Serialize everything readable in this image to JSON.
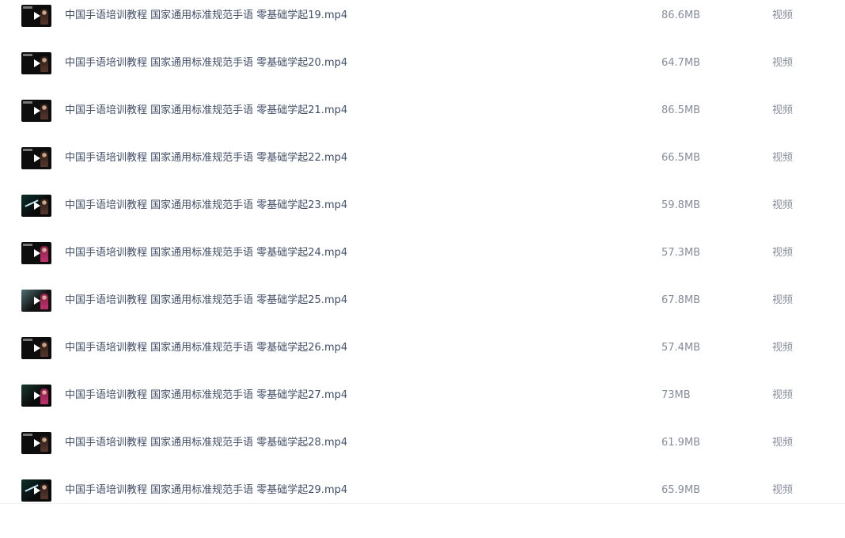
{
  "files": [
    {
      "name": "中国手语培训教程 国家通用标准规范手语 零基础学起19.mp4",
      "size": "86.6MB",
      "type": "视频",
      "thumb": "video-thumbnail"
    },
    {
      "name": "中国手语培训教程 国家通用标准规范手语 零基础学起20.mp4",
      "size": "64.7MB",
      "type": "视频",
      "thumb": "video-thumbnail"
    },
    {
      "name": "中国手语培训教程 国家通用标准规范手语 零基础学起21.mp4",
      "size": "86.5MB",
      "type": "视频",
      "thumb": "video-thumbnail"
    },
    {
      "name": "中国手语培训教程 国家通用标准规范手语 零基础学起22.mp4",
      "size": "66.5MB",
      "type": "视频",
      "thumb": "video-thumbnail"
    },
    {
      "name": "中国手语培训教程 国家通用标准规范手语 零基础学起23.mp4",
      "size": "59.8MB",
      "type": "视频",
      "thumb": "video-thumbnail"
    },
    {
      "name": "中国手语培训教程 国家通用标准规范手语 零基础学起24.mp4",
      "size": "57.3MB",
      "type": "视频",
      "thumb": "video-thumbnail"
    },
    {
      "name": "中国手语培训教程 国家通用标准规范手语 零基础学起25.mp4",
      "size": "67.8MB",
      "type": "视频",
      "thumb": "video-thumbnail"
    },
    {
      "name": "中国手语培训教程 国家通用标准规范手语 零基础学起26.mp4",
      "size": "57.4MB",
      "type": "视频",
      "thumb": "video-thumbnail"
    },
    {
      "name": "中国手语培训教程 国家通用标准规范手语 零基础学起27.mp4",
      "size": "73MB",
      "type": "视频",
      "thumb": "video-thumbnail"
    },
    {
      "name": "中国手语培训教程 国家通用标准规范手语 零基础学起28.mp4",
      "size": "61.9MB",
      "type": "视频",
      "thumb": "video-thumbnail"
    },
    {
      "name": "中国手语培训教程 国家通用标准规范手语 零基础学起29.mp4",
      "size": "65.9MB",
      "type": "视频",
      "thumb": "video-thumbnail"
    }
  ],
  "colors": {
    "file_name_text": "#424e67",
    "meta_text": "#878c9c",
    "background": "#ffffff"
  }
}
